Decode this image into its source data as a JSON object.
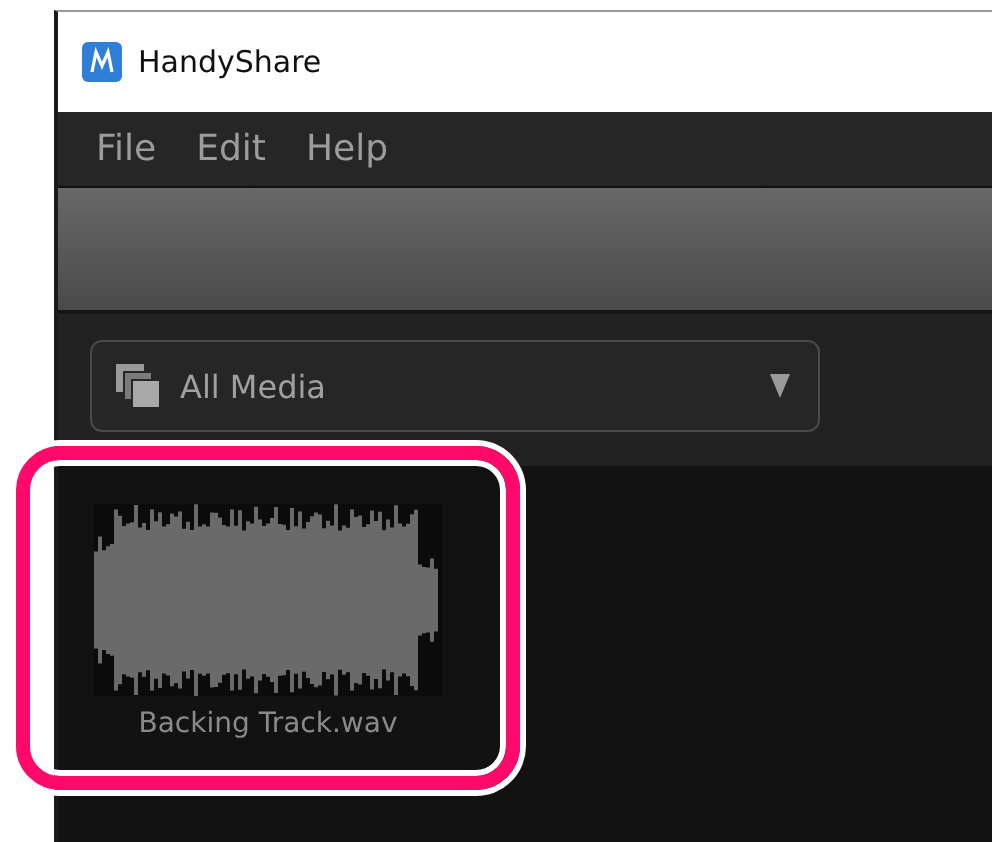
{
  "window": {
    "title": "HandyShare"
  },
  "menu": [
    "File",
    "Edit",
    "Help"
  ],
  "filter": {
    "value": "All Media"
  },
  "media": [
    {
      "name": "Backing Track.wav",
      "highlighted": true
    }
  ]
}
